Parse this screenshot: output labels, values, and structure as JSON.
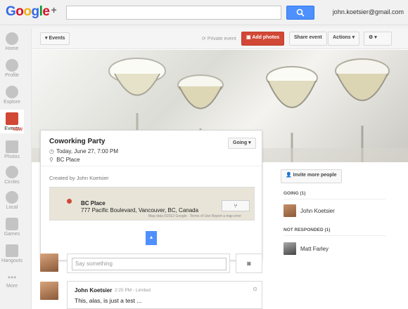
{
  "topbar": {
    "logo": "Google+",
    "user_email": "john.koetsier@gmail.com"
  },
  "leftnav": {
    "items": [
      {
        "label": "Home",
        "icon": "home-icon"
      },
      {
        "label": "Profile",
        "icon": "profile-icon"
      },
      {
        "label": "Explore",
        "icon": "explore-icon"
      },
      {
        "label": "Events",
        "icon": "events-icon",
        "badge": "NEW"
      },
      {
        "label": "Photos",
        "icon": "photos-icon"
      },
      {
        "label": "Circles",
        "icon": "circles-icon"
      },
      {
        "label": "Local",
        "icon": "local-icon"
      },
      {
        "label": "Games",
        "icon": "games-icon"
      },
      {
        "label": "Hangouts",
        "icon": "hangouts-icon"
      },
      {
        "label": "More",
        "icon": "more-icon"
      }
    ]
  },
  "actionbar": {
    "events_label": "Events",
    "privacy_label": "Private event",
    "add_photos_label": "Add photos",
    "share_label": "Share event",
    "actions_label": "Actions"
  },
  "event": {
    "title": "Coworking Party",
    "date": "Today, June 27, 7:00 PM",
    "location": "BC Place",
    "going_label": "Going",
    "created_by": "Created by John Koetsier",
    "map": {
      "place_name": "BC Place",
      "address": "777 Pacific Boulevard, Vancouver, BC, Canada",
      "footer": "Map data ©2012 Google - Terms of Use  Report a map error"
    }
  },
  "right": {
    "invite_label": "Invite more people",
    "going_header": "GOING (1)",
    "going_people": [
      "John Koetsier"
    ],
    "not_responded_header": "NOT RESPONDED (1)",
    "not_responded_people": [
      "Matt Farley"
    ]
  },
  "comments": {
    "placeholder": "Say something",
    "post": {
      "author": "John Koetsier",
      "meta": "2:25 PM  -  Limited",
      "text": "This, alas, is just a test ..."
    }
  },
  "colors": {
    "accent_blue": "#4d90fe",
    "add_red": "#d14836"
  }
}
